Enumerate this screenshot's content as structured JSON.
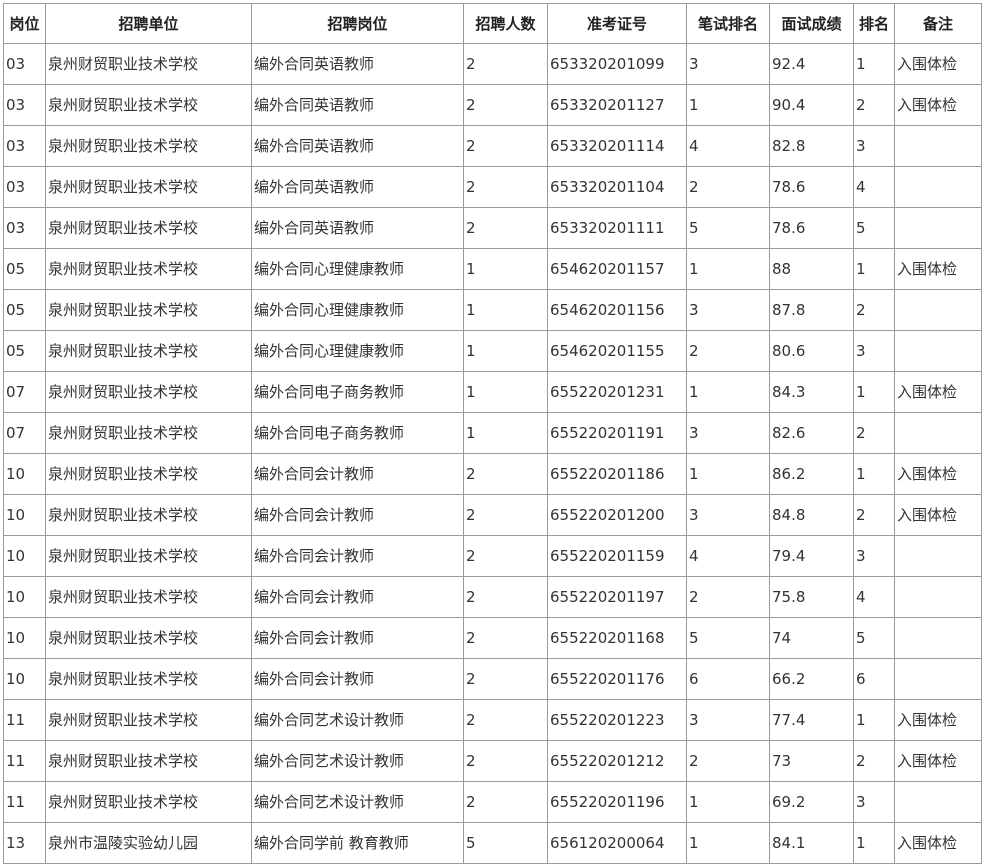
{
  "table": {
    "headers": [
      "岗位",
      "招聘单位",
      "招聘岗位",
      "招聘人数",
      "准考证号",
      "笔试排名",
      "面试成绩",
      "排名",
      "备注"
    ],
    "rows": [
      [
        "03",
        "泉州财贸职业技术学校",
        "编外合同英语教师",
        "2",
        "653320201099",
        "3",
        "92.4",
        "1",
        "入围体检"
      ],
      [
        "03",
        "泉州财贸职业技术学校",
        "编外合同英语教师",
        "2",
        "653320201127",
        "1",
        "90.4",
        "2",
        "入围体检"
      ],
      [
        "03",
        "泉州财贸职业技术学校",
        "编外合同英语教师",
        "2",
        "653320201114",
        "4",
        "82.8",
        "3",
        ""
      ],
      [
        "03",
        "泉州财贸职业技术学校",
        "编外合同英语教师",
        "2",
        "653320201104",
        "2",
        "78.6",
        "4",
        ""
      ],
      [
        "03",
        "泉州财贸职业技术学校",
        "编外合同英语教师",
        "2",
        "653320201111",
        "5",
        "78.6",
        "5",
        ""
      ],
      [
        "05",
        "泉州财贸职业技术学校",
        "编外合同心理健康教师",
        "1",
        "654620201157",
        "1",
        "88",
        "1",
        "入围体检"
      ],
      [
        "05",
        "泉州财贸职业技术学校",
        "编外合同心理健康教师",
        "1",
        "654620201156",
        "3",
        "87.8",
        "2",
        ""
      ],
      [
        "05",
        "泉州财贸职业技术学校",
        "编外合同心理健康教师",
        "1",
        "654620201155",
        "2",
        "80.6",
        "3",
        ""
      ],
      [
        "07",
        "泉州财贸职业技术学校",
        "编外合同电子商务教师",
        "1",
        "655220201231",
        "1",
        "84.3",
        "1",
        "入围体检"
      ],
      [
        "07",
        "泉州财贸职业技术学校",
        "编外合同电子商务教师",
        "1",
        "655220201191",
        "3",
        "82.6",
        "2",
        ""
      ],
      [
        "10",
        "泉州财贸职业技术学校",
        "编外合同会计教师",
        "2",
        "655220201186",
        "1",
        "86.2",
        "1",
        "入围体检"
      ],
      [
        "10",
        "泉州财贸职业技术学校",
        "编外合同会计教师",
        "2",
        "655220201200",
        "3",
        "84.8",
        "2",
        "入围体检"
      ],
      [
        "10",
        "泉州财贸职业技术学校",
        "编外合同会计教师",
        "2",
        "655220201159",
        "4",
        "79.4",
        "3",
        ""
      ],
      [
        "10",
        "泉州财贸职业技术学校",
        "编外合同会计教师",
        "2",
        "655220201197",
        "2",
        "75.8",
        "4",
        ""
      ],
      [
        "10",
        "泉州财贸职业技术学校",
        "编外合同会计教师",
        "2",
        "655220201168",
        "5",
        "74",
        "5",
        ""
      ],
      [
        "10",
        "泉州财贸职业技术学校",
        "编外合同会计教师",
        "2",
        "655220201176",
        "6",
        "66.2",
        "6",
        ""
      ],
      [
        "11",
        "泉州财贸职业技术学校",
        "编外合同艺术设计教师",
        "2",
        "655220201223",
        "3",
        "77.4",
        "1",
        "入围体检"
      ],
      [
        "11",
        "泉州财贸职业技术学校",
        "编外合同艺术设计教师",
        "2",
        "655220201212",
        "2",
        "73",
        "2",
        "入围体检"
      ],
      [
        "11",
        "泉州财贸职业技术学校",
        "编外合同艺术设计教师",
        "2",
        "655220201196",
        "1",
        "69.2",
        "3",
        ""
      ],
      [
        "13",
        "泉州市温陵实验幼儿园",
        "编外合同学前 教育教师",
        "5",
        "656120200064",
        "1",
        "84.1",
        "1",
        "入围体检"
      ]
    ]
  }
}
